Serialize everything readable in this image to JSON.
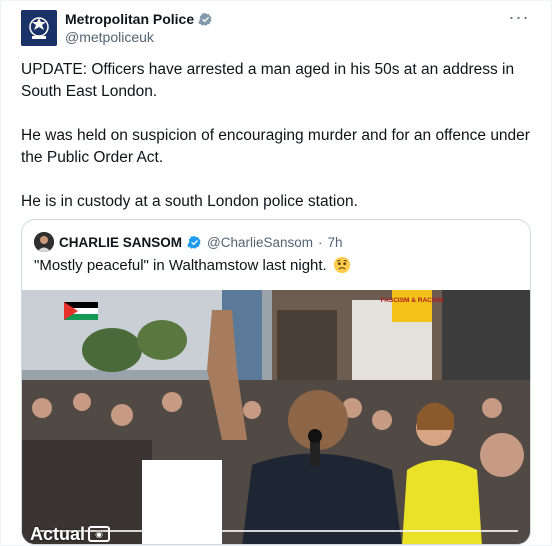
{
  "tweet": {
    "author_name": "Metropolitan Police",
    "author_handle": "@metpoliceuk",
    "more_label": "···",
    "paragraphs": [
      "UPDATE: Officers have arrested a man aged in his 50s at an address in South East London.",
      "He was held on suspicion of encouraging murder and for an offence under the Public Order Act.",
      "He is in custody at a south London police station."
    ]
  },
  "quote": {
    "author_name": "CHARLIE SANSOM",
    "author_handle": "@CharlieSansom",
    "separator": "·",
    "time": "7h",
    "text": "\"Mostly peaceful\" in Walthamstow last night.",
    "emoji": "worried-face-emoji"
  },
  "media": {
    "sign_text": "FASCISM & RACISM",
    "watermark": "Actual"
  },
  "colors": {
    "verified": "#1d9bf0",
    "avatar_bg": "#1b3268",
    "text": "#0f1419",
    "muted": "#536471"
  }
}
